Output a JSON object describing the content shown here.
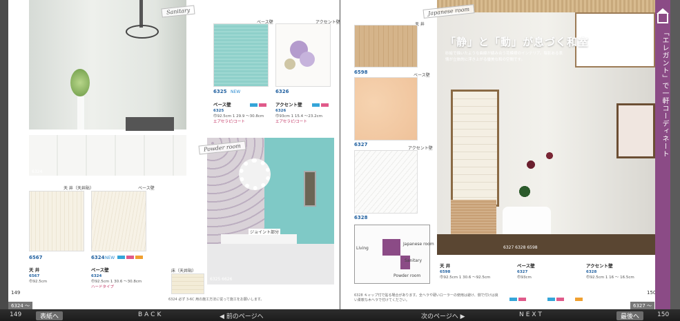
{
  "pages": {
    "left_number": "149",
    "right_number": "150"
  },
  "left": {
    "tags": {
      "sanitary": "Sanitary",
      "powder": "Powder room"
    },
    "main_photo_code": "6324",
    "ceiling_base_labels": {
      "ceiling": "天 井（天井貼）",
      "base": "ベース壁"
    },
    "swatch_codes": [
      "6567",
      "6324"
    ],
    "swatch_badge": "NEW",
    "bottom_label": "床（天井貼）",
    "spec_ceiling": {
      "title": "天 井",
      "code": "6567",
      "size": "巾92.5cm"
    },
    "spec_base": {
      "title": "ベース壁",
      "code": "6324",
      "size": "巾92.5cm 1 30.6 ～30.8cm",
      "note": "ハードタイプ"
    },
    "top_swatches": {
      "base_label": "ベース壁",
      "accent_label": "アクセント壁",
      "code_a": "6325",
      "code_b": "6326",
      "badge": "NEW"
    },
    "spec_a": {
      "title": "ベース壁",
      "code": "6325",
      "size": "巾92.5cm 1 29.9 ～30.8cm",
      "coat": "エアセラピ/コート"
    },
    "spec_b": {
      "title": "アクセント壁",
      "code": "6326",
      "size": "巾93cm 1 15.4 ～23.2cm",
      "coat": "エアセラピ/コート"
    },
    "powder_photo_code": "6325 6626",
    "powder_caption": "ジョイント部分",
    "footnote": "6324 必ず 3-6C 用の施工方法に従って施工をお願いします。"
  },
  "right": {
    "tag": "Japanese room",
    "headline": "「静」と「動」が息づく和室",
    "subhead": "砂絵で描いたような曲線が絡み合う花模様のインテリア。陰影ある表情が立体的に浮き上がる優美な和の空間です。",
    "swatch_labels": {
      "ceiling": "天 井",
      "base": "ベース壁",
      "accent": "アクセント壁"
    },
    "swatch_codes": [
      "6598",
      "6327",
      "6328"
    ],
    "photo_codes": "6327 6328 6598",
    "spec_ceiling": {
      "title": "天 井",
      "code": "6598",
      "size": "巾92.5cm 1 30.6 ～92.5cm"
    },
    "spec_base": {
      "title": "ベース壁",
      "code": "6327",
      "size": "巾93cm"
    },
    "spec_accent": {
      "title": "アクセント壁",
      "code": "6328",
      "size": "巾92.5cm 1 16 ～ 16.5cm"
    },
    "footnote": "6328 キャップ付で貼る場合があります。全ヘラや硬いローラーの使用は避け、側で付けは良い柔軟な木ヘラで付けてください。",
    "plan_labels": [
      "Living",
      "Japanese room",
      "Sanitary",
      "Powder room"
    ]
  },
  "sidetab": {
    "text": "「エレガント」で一軒コーディネート"
  },
  "bottom_bar": {
    "page_left": "149",
    "cover": "表紙へ",
    "back": "BACK",
    "prev": "◀ 前のページへ",
    "next": "次のページへ ▶",
    "next_en": "NEXT",
    "last": "最後へ",
    "page_right": "150"
  },
  "footer_labels": {
    "left": "6324 ～",
    "right": "6327 ～"
  },
  "colors": {
    "accent_purple": "#8b4b86",
    "aqua": "#8ccfc9",
    "wood": "#d7b78b",
    "beige": "#f1c8a4"
  }
}
